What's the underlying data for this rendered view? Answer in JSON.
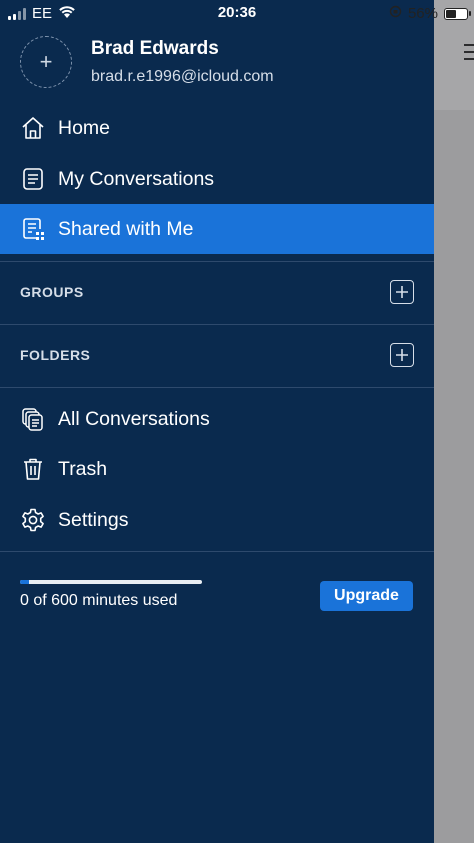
{
  "status_bar": {
    "carrier": "EE",
    "time": "20:36",
    "battery_percent": "56%",
    "battery_level": 0.56
  },
  "profile": {
    "name": "Brad Edwards",
    "email": "brad.r.e1996@icloud.com",
    "avatar_add_glyph": "+"
  },
  "nav": {
    "home": "Home",
    "my_conversations": "My Conversations",
    "shared_with_me": "Shared with Me",
    "all_conversations": "All Conversations",
    "trash": "Trash",
    "settings": "Settings"
  },
  "sections": {
    "groups": "GROUPS",
    "folders": "FOLDERS"
  },
  "usage": {
    "text": "0 of 600 minutes used",
    "progress_fraction": 0.05,
    "upgrade_label": "Upgrade"
  },
  "colors": {
    "drawer_bg": "#0a2a4e",
    "accent": "#1a73d9"
  },
  "icons": {
    "home": "home-icon",
    "my_conversations": "document-icon",
    "shared_with_me": "shared-document-icon",
    "all_conversations": "stacked-documents-icon",
    "trash": "trash-icon",
    "settings": "gear-icon",
    "add": "plus-square-icon"
  }
}
